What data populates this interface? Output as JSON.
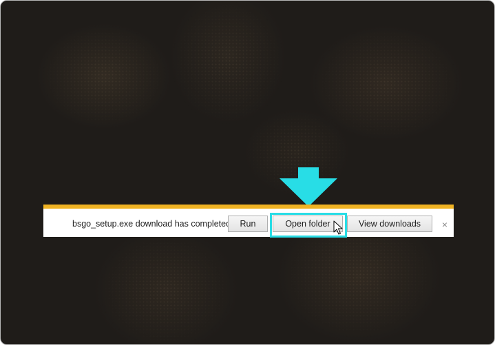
{
  "notification": {
    "message": "bsgo_setup.exe download has completed.",
    "run_label": "Run",
    "open_folder_label": "Open folder",
    "view_downloads_label": "View downloads",
    "close_glyph": "×"
  },
  "colors": {
    "notification_accent": "#f0b323",
    "highlight": "#28dde6",
    "arrow": "#28dde6"
  },
  "icons": {
    "arrow": "down-arrow-icon",
    "cursor": "mouse-pointer-icon",
    "close": "close-icon"
  }
}
